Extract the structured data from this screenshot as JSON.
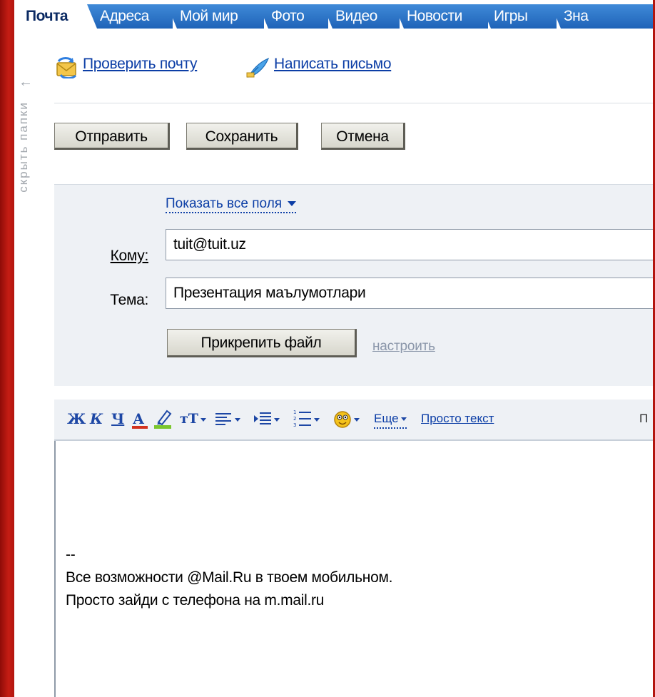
{
  "tabs": [
    {
      "label": "Почта",
      "active": true
    },
    {
      "label": "Адреса"
    },
    {
      "label": "Мой мир"
    },
    {
      "label": "Фото"
    },
    {
      "label": "Видео"
    },
    {
      "label": "Новости"
    },
    {
      "label": "Игры"
    },
    {
      "label": "Зна"
    }
  ],
  "sidebar": {
    "hide_folders_label": "скрыть папки",
    "arrow": "←"
  },
  "toplinks": {
    "check_mail": "Проверить почту",
    "compose": "Написать письмо"
  },
  "actions": {
    "send": "Отправить",
    "save": "Сохранить",
    "cancel": "Отмена"
  },
  "form": {
    "show_all_fields": "Показать все поля",
    "to_label": "Кому:",
    "to_value": "tuit@tuit.uz",
    "subject_label": "Тема:",
    "subject_value": "Презентация маълумотлари",
    "attach_button": "Прикрепить файл",
    "configure_link": "настроить"
  },
  "toolbar": {
    "bold": "Ж",
    "italic": "К",
    "underline": "Ч",
    "color": "А",
    "font_size": "тT",
    "more": "Еще",
    "plain_text": "Просто текст",
    "cut_label": "П"
  },
  "editor": {
    "signature_dash": "--",
    "signature_line1": "Все возможности @Mail.Ru в твоем мобильном.",
    "signature_line2": "Просто зайди с телефона на m.mail.ru"
  },
  "colors": {
    "frame_red": "#b3150f",
    "tab_blue": "#2a72c8",
    "link_blue": "#0c3ea6",
    "panel_bg": "#eef1f5",
    "font_color_bar": "#d2321e"
  },
  "icons": {
    "check_mail": "refresh-mail-icon",
    "compose": "feather-pen-icon",
    "highlight": "highlighter-icon",
    "align": "align-left-icon",
    "indent": "indent-icon",
    "list": "numbered-list-icon",
    "smile": "smiley-icon"
  }
}
